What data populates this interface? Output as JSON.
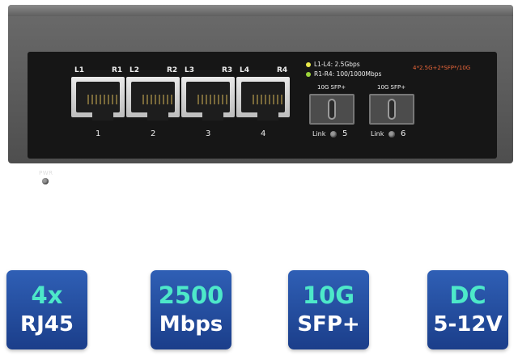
{
  "device": {
    "power_label": "PWR",
    "rj45_ports": [
      {
        "left_led": "L1",
        "right_led": "R1",
        "number": "1"
      },
      {
        "left_led": "L2",
        "right_led": "R2",
        "number": "2"
      },
      {
        "left_led": "L3",
        "right_led": "R3",
        "number": "3"
      },
      {
        "left_led": "L4",
        "right_led": "R4",
        "number": "4"
      }
    ],
    "legend": [
      {
        "text": "L1-L4: 2.5Gbps",
        "color": "#e8e84a"
      },
      {
        "text": "R1-R4: 100/1000Mbps",
        "color": "#9bd33a"
      }
    ],
    "speed_note": "4*2.5G+2*SFP*/10G",
    "sfp_ports": [
      {
        "title": "10G SFP+",
        "link_label": "Link",
        "number": "5"
      },
      {
        "title": "10G SFP+",
        "link_label": "Link",
        "number": "6"
      }
    ]
  },
  "badges": [
    {
      "top": "4x",
      "bottom": "RJ45"
    },
    {
      "top": "2500",
      "bottom": "Mbps"
    },
    {
      "top": "10G",
      "bottom": "SFP+"
    },
    {
      "top": "DC",
      "bottom": "5-12V"
    }
  ],
  "colors": {
    "badge_bg": "#2a56a8",
    "badge_accent": "#4de8c9",
    "led_green": "#c5e43a"
  }
}
